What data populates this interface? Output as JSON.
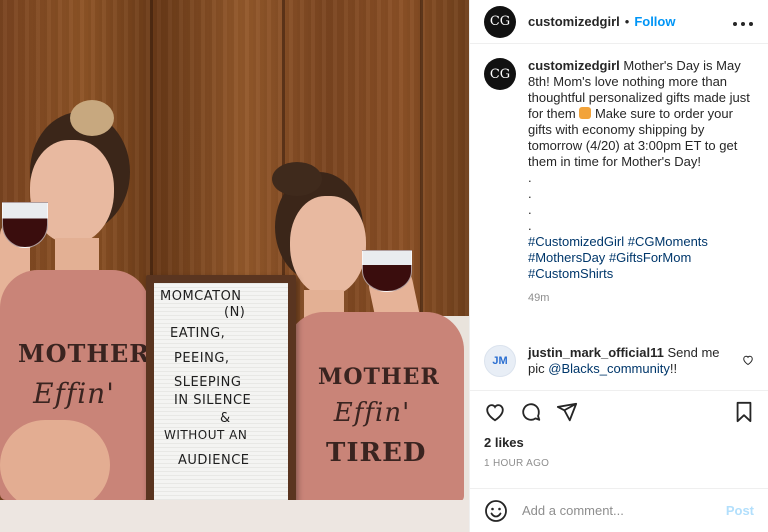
{
  "post": {
    "image_alt": "Two women in pink 'Mother Effin' tank tops drinking red wine next to a letter board sign",
    "shirt_left": {
      "line1": "MOTHER",
      "line2": "Effin'"
    },
    "shirt_right": {
      "line1": "MOTHER",
      "line2": "Effin'",
      "line3": "TIRED"
    },
    "letter_board": [
      "MOMCATON",
      "(N)",
      "EATING,",
      "PEEING,",
      "SLEEPING",
      "IN SILENCE",
      "&",
      "WITHOUT AN",
      "AUDIENCE"
    ]
  },
  "header": {
    "avatar_initials": "CG",
    "username": "customizedgirl",
    "separator": "•",
    "follow_label": "Follow",
    "more_label": "•••"
  },
  "caption": {
    "avatar_initials": "CG",
    "username": "customizedgirl",
    "text_before_emoji": "Mother's Day is May 8th! Mom's love nothing more than thoughtful personalized gifts made just for them",
    "emoji_name": "gift-emoji",
    "text_after_emoji": "Make sure to order your gifts with economy shipping by tomorrow (4/20) at 3:00pm ET to get them in time for Mother's Day!",
    "dots": [
      ".",
      ".",
      ".",
      "."
    ],
    "hashtags": [
      "#CustomizedGirl",
      "#CGMoments",
      "#MothersDay",
      "#GiftsForMom",
      "#CustomShirts"
    ],
    "time": "49m"
  },
  "comment": {
    "avatar_initials": "JM",
    "username": "justin_mark_official11",
    "text": "Send me pic",
    "mention": "@Blacks_community",
    "suffix": "!!"
  },
  "actions": {
    "icons": [
      "heart-icon",
      "comment-icon",
      "share-icon",
      "bookmark-icon"
    ]
  },
  "likes": "2 likes",
  "posted_ago": "1 HOUR AGO",
  "add_comment": {
    "placeholder": "Add a comment...",
    "post_label": "Post"
  },
  "colors": {
    "accent": "#0095f6",
    "link": "#00376b",
    "post_disabled": "#b2dffc",
    "muted": "#8e8e8e"
  }
}
